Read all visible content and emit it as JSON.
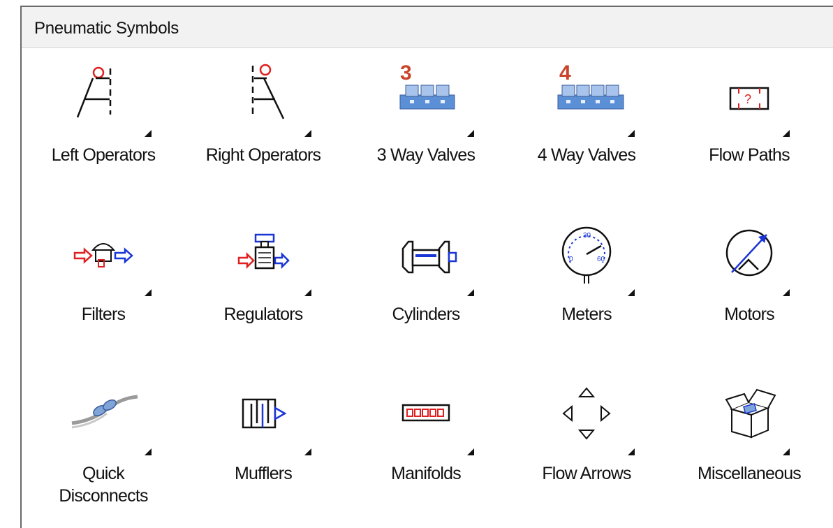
{
  "panel": {
    "title": "Pneumatic Symbols"
  },
  "items": [
    {
      "label": "Left Operators",
      "icon": "left-operators-icon"
    },
    {
      "label": "Right Operators",
      "icon": "right-operators-icon"
    },
    {
      "label": "3 Way Valves",
      "icon": "three-way-valves-icon",
      "badge": "3"
    },
    {
      "label": "4 Way Valves",
      "icon": "four-way-valves-icon",
      "badge": "4"
    },
    {
      "label": "Flow Paths",
      "icon": "flow-paths-icon"
    },
    {
      "label": "Filters",
      "icon": "filters-icon"
    },
    {
      "label": "Regulators",
      "icon": "regulators-icon"
    },
    {
      "label": "Cylinders",
      "icon": "cylinders-icon"
    },
    {
      "label": "Meters",
      "icon": "meters-icon"
    },
    {
      "label": "Motors",
      "icon": "motors-icon"
    },
    {
      "label": "Quick Disconnects",
      "icon": "quick-disconnects-icon"
    },
    {
      "label": "Mufflers",
      "icon": "mufflers-icon"
    },
    {
      "label": "Manifolds",
      "icon": "manifolds-icon"
    },
    {
      "label": "Flow Arrows",
      "icon": "flow-arrows-icon"
    },
    {
      "label": "Miscellaneous",
      "icon": "miscellaneous-icon"
    }
  ],
  "colors": {
    "symbol_red": "#e02020",
    "symbol_blue": "#1a35d6",
    "valve_blue": "#5b8fd6",
    "badge_orange": "#c9442a"
  }
}
